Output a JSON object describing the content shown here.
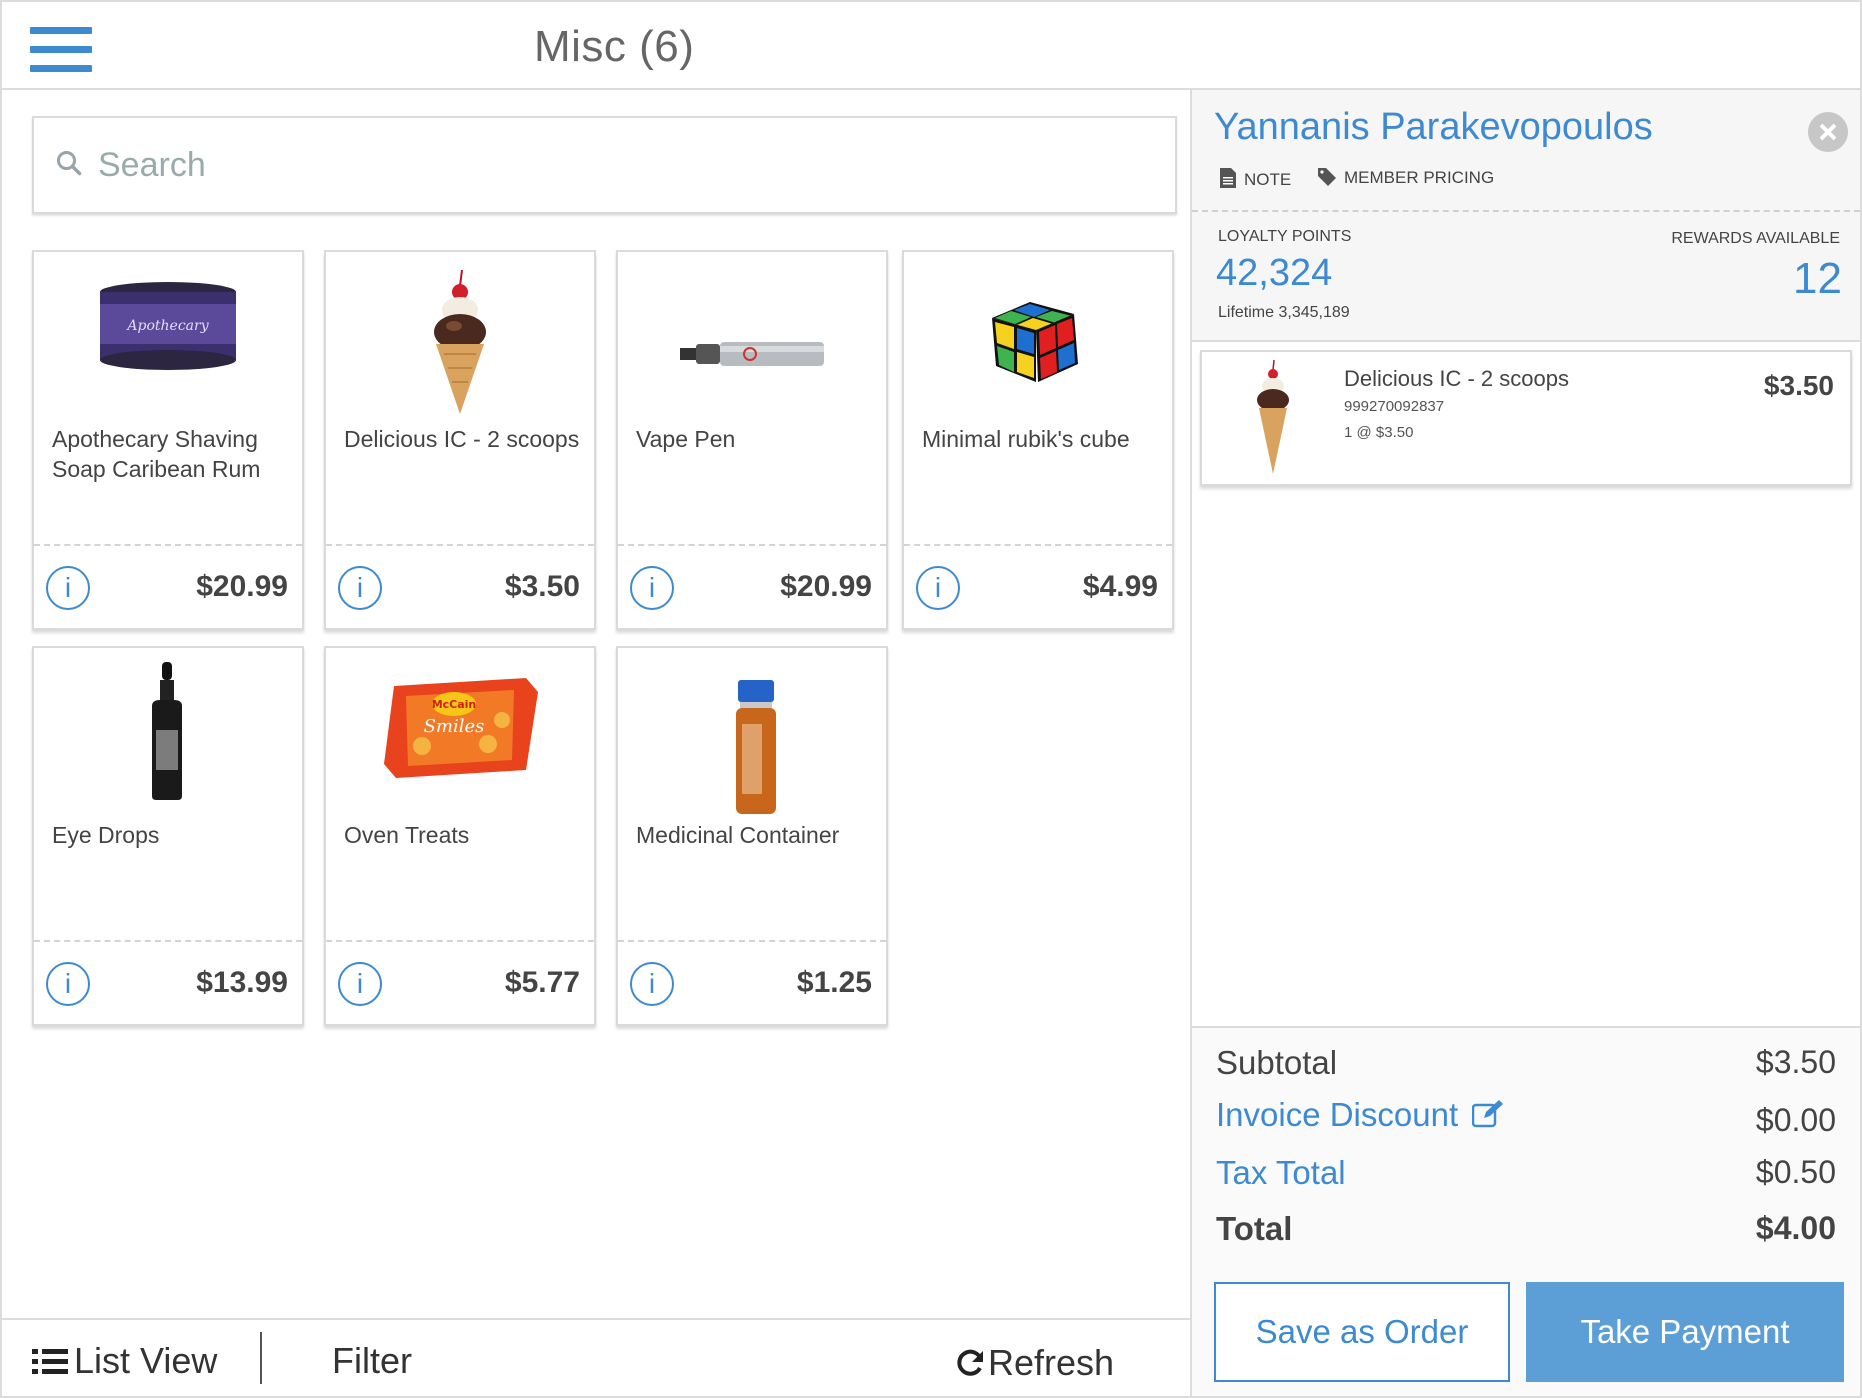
{
  "header": {
    "title": "Misc (6)"
  },
  "search": {
    "placeholder": "Search"
  },
  "products": [
    {
      "name": "Apothecary Shaving Soap Caribean Rum",
      "price": "$20.99",
      "image": "apothecary-jar-image"
    },
    {
      "name": "Delicious IC -  2 scoops",
      "price": "$3.50",
      "image": "ice-cream-cone-image"
    },
    {
      "name": "Vape Pen",
      "price": "$20.99",
      "image": "vape-pen-image"
    },
    {
      "name": "Minimal rubik's cube",
      "price": "$4.99",
      "image": "rubiks-cube-image"
    },
    {
      "name": "Eye Drops",
      "price": "$13.99",
      "image": "dropper-bottle-image"
    },
    {
      "name": "Oven Treats",
      "price": "$5.77",
      "image": "smiles-bag-image"
    },
    {
      "name": "Medicinal Container",
      "price": "$1.25",
      "image": "vial-image"
    }
  ],
  "product_image_text": {
    "apothecary": "Apothecary",
    "mccain": "McCain",
    "smiles": "Smiles"
  },
  "info_icon_glyph": "i",
  "toolbar": {
    "list_view": "List View",
    "filter": "Filter",
    "refresh": "Refresh"
  },
  "customer": {
    "name": "Yannanis Parakevopoulos",
    "note_label": "NOTE",
    "member_pricing_label": "MEMBER PRICING",
    "loyalty_label": "LOYALTY POINTS",
    "loyalty_points": "42,324",
    "lifetime": "Lifetime 3,345,189",
    "rewards_label": "REWARDS AVAILABLE",
    "rewards_available": "12"
  },
  "cart": {
    "items": [
      {
        "name": "Delicious IC -  2 scoops",
        "sku": "999270092837",
        "qty_line": "1 @ $3.50",
        "price": "$3.50"
      }
    ]
  },
  "totals": {
    "subtotal_label": "Subtotal",
    "subtotal": "$3.50",
    "discount_label": "Invoice Discount",
    "discount": "$0.00",
    "tax_label": "Tax Total",
    "tax": "$0.50",
    "total_label": "Total",
    "total": "$4.00"
  },
  "actions": {
    "save_order": "Save as Order",
    "take_payment": "Take Payment"
  },
  "colors": {
    "accent": "#3d8ad0",
    "pay_button": "#5b9fd6",
    "border": "#dcdcdc"
  }
}
